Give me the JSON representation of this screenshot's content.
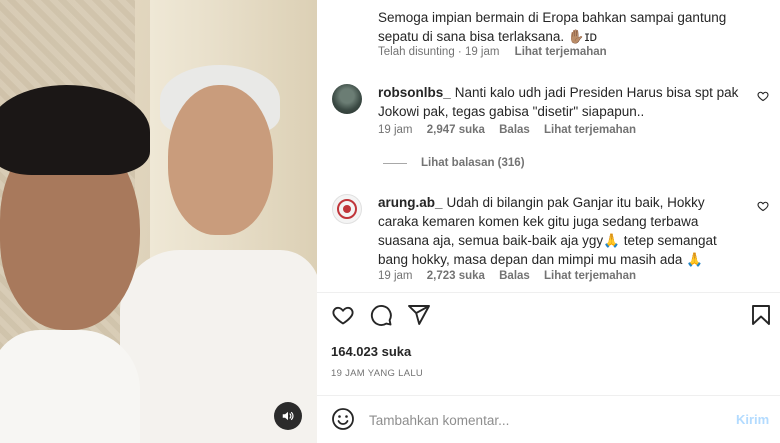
{
  "caption": {
    "text": "Semoga impian bermain di Eropa bahkan sampai gantung sepatu di sana bisa terlaksana. ✋🏽ɪᴅ",
    "meta": {
      "edited": "Telah disunting · 19 jam",
      "translate": "Lihat terjemahan"
    }
  },
  "comments": [
    {
      "username": "robsonlbs_",
      "text": "Nanti kalo udh jadi Presiden Harus bisa spt pak Jokowi pak, tegas gabisa \"disetir\" siapapun..",
      "time": "19 jam",
      "likes": "2,947 suka",
      "reply": "Balas",
      "translate": "Lihat terjemahan",
      "avatar_icon": "user-avatar-photo"
    },
    {
      "username": "arung.ab_",
      "text": "Udah di bilangin pak Ganjar itu baik, Hokky caraka kemaren komen kek gitu juga sedang terbawa suasana aja, semua baik-baik aja ygy🙏 tetep semangat bang hokky, masa depan dan mimpi mu masih ada 🙏",
      "time": "19 jam",
      "likes": "2,723 suka",
      "reply": "Balas",
      "translate": "Lihat terjemahan",
      "avatar_icon": "user-avatar-logo"
    }
  ],
  "view_replies": "Lihat balasan (316)",
  "post": {
    "likes": "164.023 suka",
    "time": "19 JAM YANG LALU"
  },
  "composer": {
    "placeholder": "Tambahkan komentar...",
    "send_label": "Kirim"
  },
  "icons": {
    "like": "heart-icon",
    "comment": "comment-icon",
    "share": "send-icon",
    "save": "bookmark-icon",
    "emoji": "emoji-icon",
    "mute": "speaker-icon"
  },
  "colors": {
    "send_disabled": "#b3dbff",
    "secondary_text": "#737373"
  }
}
